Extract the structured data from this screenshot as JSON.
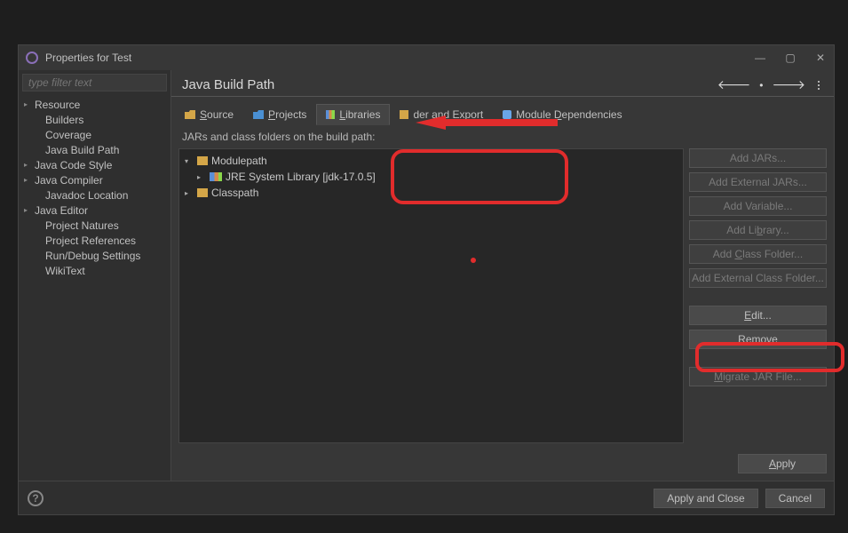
{
  "titlebar": {
    "title": "Properties for Test"
  },
  "filter": {
    "placeholder": "type filter text"
  },
  "sidebar": {
    "items": [
      {
        "label": "Resource",
        "expandable": true
      },
      {
        "label": "Builders"
      },
      {
        "label": "Coverage"
      },
      {
        "label": "Java Build Path"
      },
      {
        "label": "Java Code Style",
        "expandable": true
      },
      {
        "label": "Java Compiler",
        "expandable": true
      },
      {
        "label": "Javadoc Location"
      },
      {
        "label": "Java Editor",
        "expandable": true
      },
      {
        "label": "Project Natures"
      },
      {
        "label": "Project References"
      },
      {
        "label": "Run/Debug Settings"
      },
      {
        "label": "WikiText"
      }
    ]
  },
  "header": {
    "title": "Java Build Path"
  },
  "tabs": [
    {
      "icon": "folder",
      "label": "Source"
    },
    {
      "icon": "folder-blue",
      "label": "Projects"
    },
    {
      "icon": "lib",
      "label": "Libraries",
      "active": true
    },
    {
      "icon": "order",
      "label": "der and Export"
    },
    {
      "icon": "module",
      "label": "Module Dependencies"
    }
  ],
  "desc": "JARs and class folders on the build path:",
  "list": [
    {
      "label": "Modulepath",
      "icon": "mp",
      "expandable": true,
      "level": 0,
      "open": true
    },
    {
      "label": "JRE System Library [jdk-17.0.5]",
      "icon": "jre",
      "expandable": true,
      "level": 1
    },
    {
      "label": "Classpath",
      "icon": "cp",
      "expandable": true,
      "level": 0
    }
  ],
  "buttons": {
    "addJars": "Add JARs...",
    "addExtJars": "Add External JARs...",
    "addVariable": "Add Variable...",
    "addLibrary": "Add Library...",
    "addClassFolder": "Add Class Folder...",
    "addExtClassFolder": "Add External Class Folder...",
    "edit": "Edit...",
    "remove": "Remove",
    "migrate": "Migrate JAR File...",
    "apply": "Apply"
  },
  "footer": {
    "applyClose": "Apply and Close",
    "cancel": "Cancel"
  }
}
